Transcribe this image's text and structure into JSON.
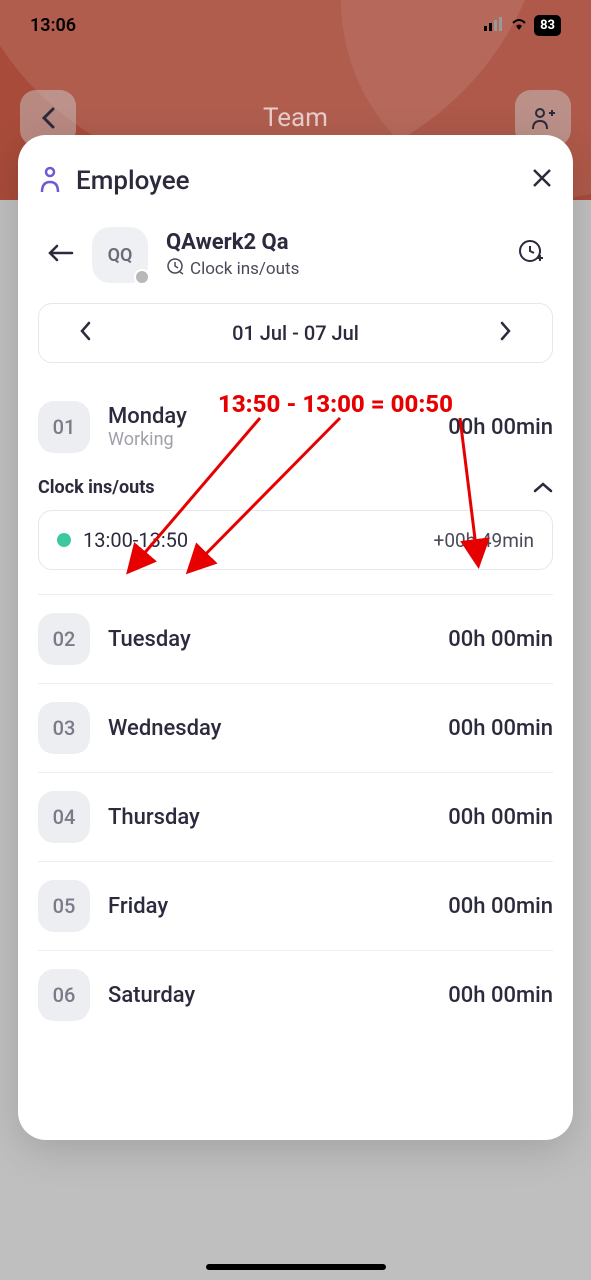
{
  "status": {
    "time": "13:06",
    "battery": "83"
  },
  "nav": {
    "title": "Team"
  },
  "modal": {
    "title": "Employee",
    "employee": {
      "initials": "QQ",
      "name": "QAwerk2 Qa",
      "subtitle": "Clock ins/outs"
    },
    "dateRange": "01 Jul - 07 Jul",
    "expandedLabel": "Clock ins/outs",
    "clockEntry": {
      "range": "13:00-13:50",
      "duration": "+00h 49min"
    },
    "days": [
      {
        "num": "01",
        "name": "Monday",
        "sub": "Working",
        "total": "00h 00min",
        "expanded": true
      },
      {
        "num": "02",
        "name": "Tuesday",
        "sub": "",
        "total": "00h 00min",
        "expanded": false
      },
      {
        "num": "03",
        "name": "Wednesday",
        "sub": "",
        "total": "00h 00min",
        "expanded": false
      },
      {
        "num": "04",
        "name": "Thursday",
        "sub": "",
        "total": "00h 00min",
        "expanded": false
      },
      {
        "num": "05",
        "name": "Friday",
        "sub": "",
        "total": "00h 00min",
        "expanded": false
      },
      {
        "num": "06",
        "name": "Saturday",
        "sub": "",
        "total": "00h 00min",
        "expanded": false
      }
    ]
  },
  "annotation": {
    "text": "13:50 - 13:00 = 00:50"
  }
}
